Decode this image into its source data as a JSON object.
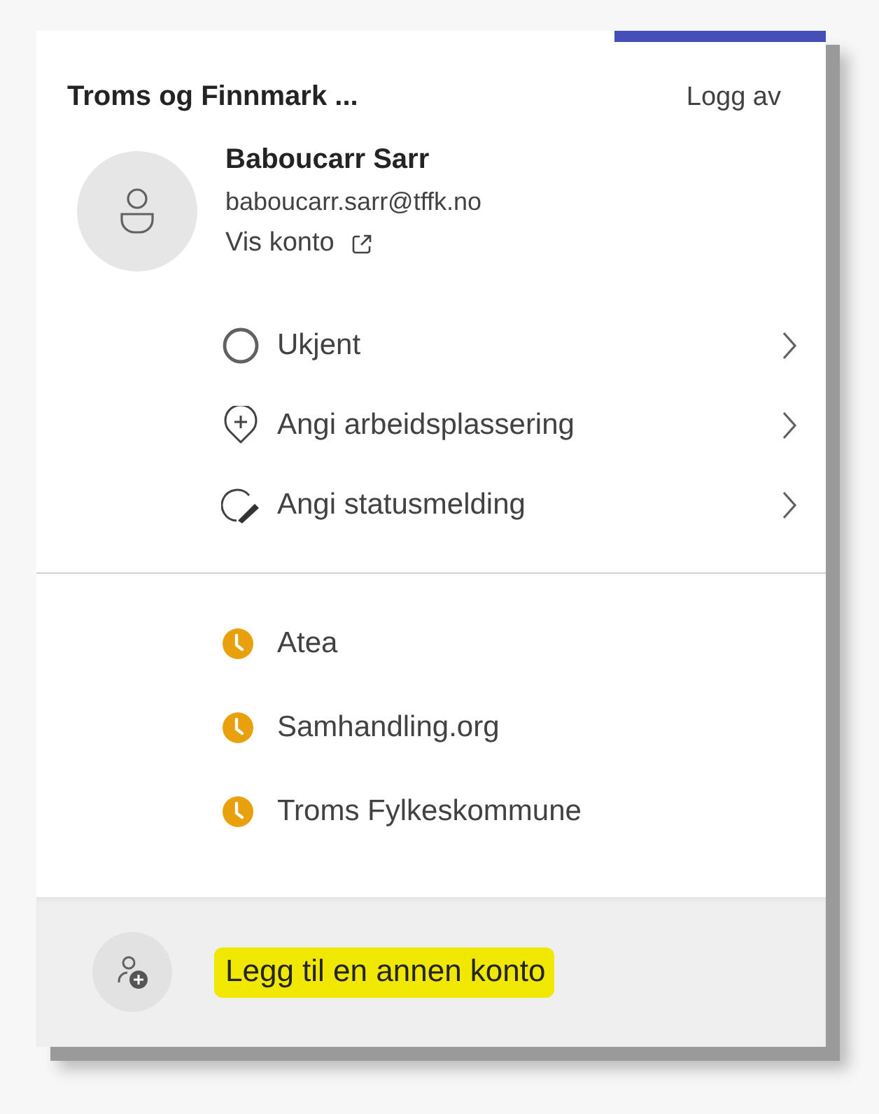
{
  "header": {
    "organization": "Troms og Finnmark ...",
    "sign_out": "Logg av"
  },
  "profile": {
    "name": "Baboucarr Sarr",
    "email": "baboucarr.sarr@tffk.no",
    "view_account": "Vis konto"
  },
  "status_items": [
    {
      "kind": "presence",
      "label": "Ukjent"
    },
    {
      "kind": "location",
      "label": "Angi arbeidsplassering"
    },
    {
      "kind": "message",
      "label": "Angi statusmelding"
    }
  ],
  "organizations": [
    {
      "name": "Atea",
      "color": "#e8a10c"
    },
    {
      "name": "Samhandling.org",
      "color": "#e8a10c"
    },
    {
      "name": "Troms Fylkeskommune",
      "color": "#e8a10c"
    }
  ],
  "add_account": {
    "label": "Legg til en annen konto",
    "highlighted": true
  }
}
